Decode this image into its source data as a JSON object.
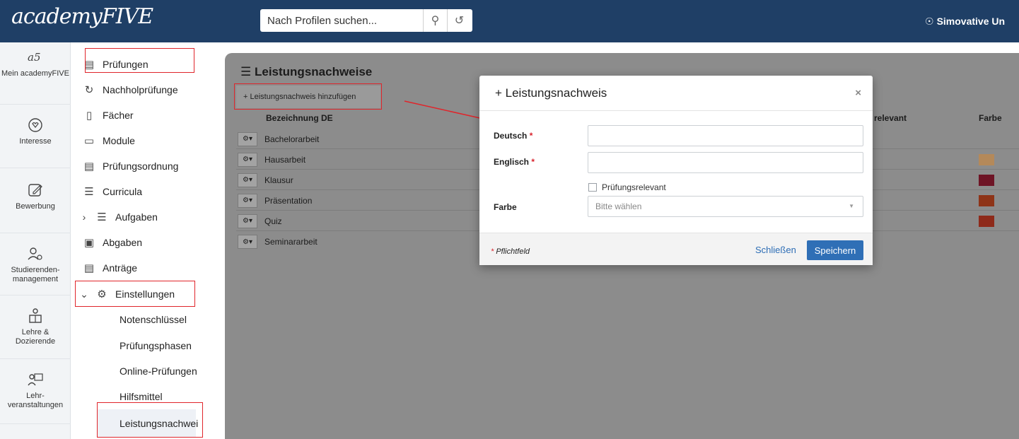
{
  "header": {
    "logo": "academyFIVE",
    "search_placeholder": "Nach Profilen suchen...",
    "search_icon": "search-icon",
    "history_icon": "history-icon",
    "location": "Simovative Un",
    "location_icon": "location-pin-icon"
  },
  "rail": {
    "items": [
      {
        "label": "Mein academyFIVE",
        "icon": "a5-logo-icon"
      },
      {
        "label": "Interesse",
        "icon": "heart-hand-icon"
      },
      {
        "label": "Bewerbung",
        "icon": "edit-icon"
      },
      {
        "label": "Studierenden-management",
        "icon": "user-gear-icon"
      },
      {
        "label": "Lehre & Dozierende",
        "icon": "teacher-icon"
      },
      {
        "label": "Lehr-veranstaltungen",
        "icon": "presentation-icon"
      }
    ]
  },
  "menu": {
    "items": [
      {
        "label": "Prüfungen",
        "icon": "clipboard-icon"
      },
      {
        "label": "Nachholprüfunge",
        "icon": "refresh-icon"
      },
      {
        "label": "Fächer",
        "icon": "document-icon"
      },
      {
        "label": "Module",
        "icon": "folder-icon"
      },
      {
        "label": "Prüfungsordnung",
        "icon": "book-icon"
      },
      {
        "label": "Curricula",
        "icon": "list-icon"
      },
      {
        "label": "Aufgaben",
        "icon": "checklist-icon"
      },
      {
        "label": "Abgaben",
        "icon": "hand-document-icon"
      },
      {
        "label": "Anträge",
        "icon": "file-text-icon"
      },
      {
        "label": "Einstellungen",
        "icon": "gear-icon"
      }
    ],
    "sub_items": [
      "Notenschlüssel",
      "Prüfungsphasen",
      "Online-Prüfungen",
      "Hilfsmittel",
      "Leistungsnachwei"
    ]
  },
  "panel": {
    "title": "Leistungsnachweise",
    "add_button": "+ Leistungsnachweis hinzufügen",
    "columns": {
      "name": "Bezeichnung DE",
      "relevant": "relevant",
      "color": "Farbe"
    },
    "rows": [
      {
        "name": "Bachelorarbeit",
        "color": ""
      },
      {
        "name": "Hausarbeit",
        "color": "#b4895a"
      },
      {
        "name": "Klausur",
        "color": "#6e1425"
      },
      {
        "name": "Präsentation",
        "color": "#8e3418"
      },
      {
        "name": "Quiz",
        "color": "#8e2a1a"
      },
      {
        "name": "Seminararbeit",
        "color": ""
      }
    ]
  },
  "modal": {
    "title": "+ Leistungsnachweis",
    "close": "×",
    "fields": {
      "deutsch": "Deutsch",
      "englisch": "Englisch",
      "required_mark": "*",
      "checkbox": "Prüfungsrelevant",
      "farbe": "Farbe",
      "farbe_placeholder": "Bitte wählen"
    },
    "footer": {
      "required_note": "* Pflichtfeld",
      "close_label": "Schließen",
      "save_label": "Speichern"
    }
  }
}
